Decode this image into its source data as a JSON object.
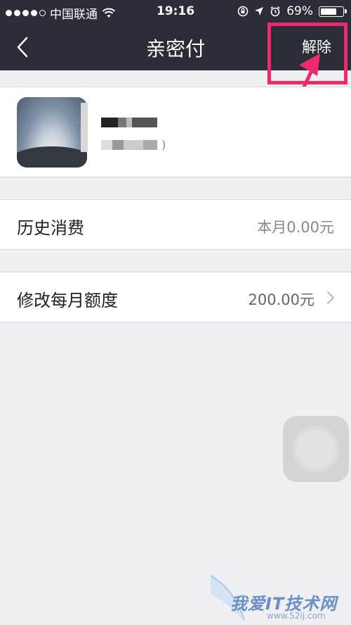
{
  "status": {
    "carrier": "中国联通",
    "time": "19:16",
    "battery": "69%"
  },
  "nav": {
    "title": "亲密付",
    "action": "解除"
  },
  "rows": [
    {
      "label": "历史消费",
      "value": "本月0.00元"
    },
    {
      "label": "修改每月额度",
      "value": "200.00元"
    }
  ],
  "watermark": {
    "text": "我爱IT技术网",
    "url": "www.52ij.com"
  },
  "colors": {
    "nav_bg": "#2a2d36",
    "highlight": "#ee2a6b",
    "page_bg": "#efeff4"
  }
}
